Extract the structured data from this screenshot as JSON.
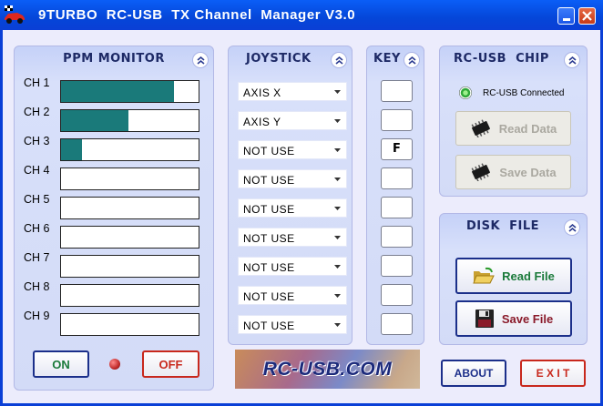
{
  "window": {
    "title": "9TURBO  RC-USB  TX Channel  Manager V3.0"
  },
  "ppm_monitor": {
    "title": "PPM MONITOR",
    "channels": [
      {
        "label": "CH 1",
        "level": 0.82
      },
      {
        "label": "CH 2",
        "level": 0.49
      },
      {
        "label": "CH 3",
        "level": 0.15
      },
      {
        "label": "CH 4",
        "level": 0
      },
      {
        "label": "CH 5",
        "level": 0
      },
      {
        "label": "CH 6",
        "level": 0
      },
      {
        "label": "CH 7",
        "level": 0
      },
      {
        "label": "CH 8",
        "level": 0
      },
      {
        "label": "CH 9",
        "level": 0
      }
    ],
    "on_label": "ON",
    "off_label": "OFF",
    "fill_color": "#1a7a7a"
  },
  "joystick": {
    "title": "JOYSTICK",
    "items": [
      "AXIS X",
      "AXIS Y",
      "NOT USE",
      "NOT USE",
      "NOT USE",
      "NOT USE",
      "NOT USE",
      "NOT USE",
      "NOT USE"
    ]
  },
  "key": {
    "title": "KEY",
    "items": [
      "",
      "",
      "F",
      "",
      "",
      "",
      "",
      "",
      ""
    ]
  },
  "chip": {
    "title": "RC-USB  CHIP",
    "status": "RC-USB Connected",
    "status_color": "#2fa838",
    "read_label": "Read Data",
    "save_label": "Save Data"
  },
  "disk": {
    "title": "DISK  FILE",
    "read_label": "Read File",
    "save_label": "Save File"
  },
  "logo": {
    "text": "RC-USB.COM"
  },
  "footer": {
    "about_label": "ABOUT",
    "exit_label": "E X I T"
  },
  "colors": {
    "title_bar": "#0a3fd6",
    "accent_red": "#c8281c",
    "accent_navy": "#1b2f8a"
  }
}
